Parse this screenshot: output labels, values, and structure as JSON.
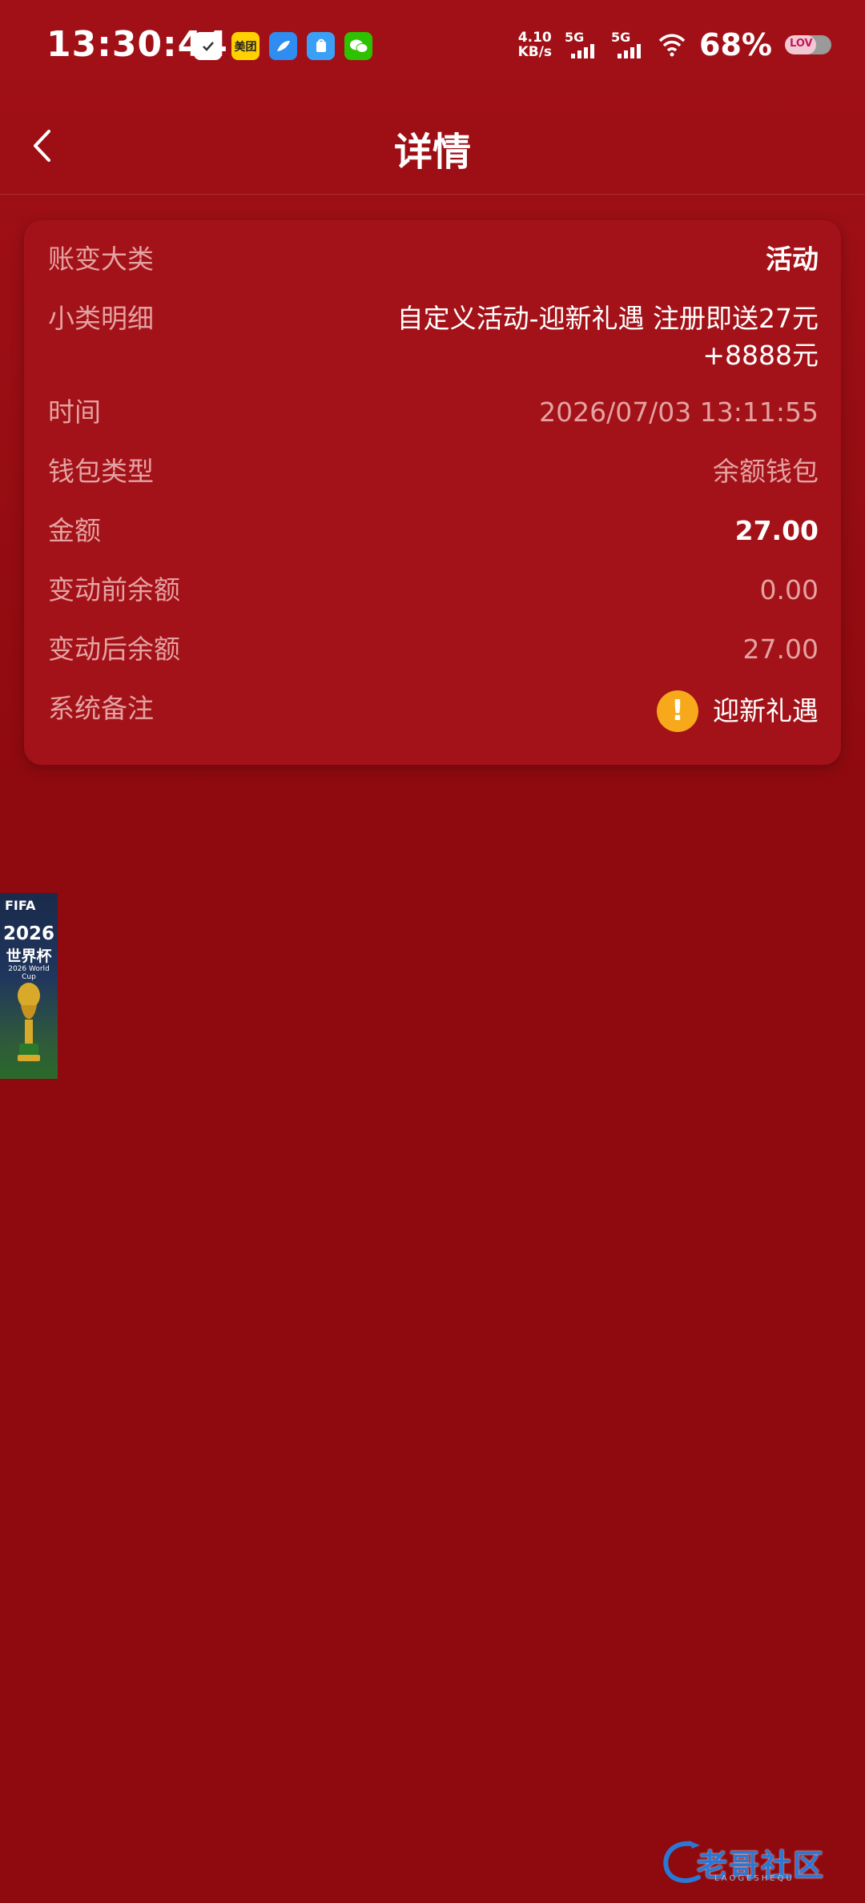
{
  "status_bar": {
    "time": "13:30:44",
    "app_icons": [
      {
        "name": "tasks-app-icon",
        "label": "✓",
        "color": "#ffffff"
      },
      {
        "name": "meituan-app-icon",
        "label": "美团",
        "color": "#ffd100"
      },
      {
        "name": "feather-app-icon",
        "label": "",
        "color": "#2f8cf0"
      },
      {
        "name": "store-app-icon",
        "label": "",
        "color": "#3aa0f7"
      },
      {
        "name": "wechat-app-icon",
        "label": "",
        "color": "#2dc100"
      }
    ],
    "net_speed_value": "4.10",
    "net_speed_unit": "KB/s",
    "sim1_label": "5G",
    "sim2_label": "5G",
    "battery_percent": "68%",
    "battery_level": 0.68,
    "battery_brand": "LOV"
  },
  "nav": {
    "title": "详情"
  },
  "detail": {
    "rows": [
      {
        "label": "账变大类",
        "value": "活动"
      },
      {
        "label": "小类明细",
        "value": "自定义活动-迎新礼遇 注册即送27元+8888元"
      },
      {
        "label": "时间",
        "value": "2026/07/03 13:11:55"
      },
      {
        "label": "钱包类型",
        "value": "余额钱包"
      },
      {
        "label": "金额",
        "value": "27.00"
      },
      {
        "label": "变动前余额",
        "value": "0.00"
      },
      {
        "label": "变动后余额",
        "value": "27.00"
      },
      {
        "label": "系统备注",
        "value": "迎新礼遇"
      }
    ]
  },
  "banner": {
    "logo_text": "FIFA",
    "year": "2026",
    "title_cn": "世界杯",
    "title_en": "2026 World Cup"
  },
  "watermark": {
    "text": "老哥社区",
    "sub": "LAOGESHEQU"
  },
  "colors": {
    "background": "#8e0a0e",
    "card": "#a31218",
    "label_text": "#e4a2a2",
    "warning": "#f7a81b"
  }
}
